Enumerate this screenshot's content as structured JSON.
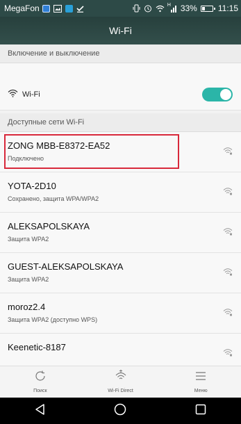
{
  "status_bar": {
    "carrier": "MegaFon",
    "signal_label": "H",
    "battery_text": "33%",
    "battery_level": 0.33,
    "time": "11:15"
  },
  "header": {
    "title": "Wi-Fi"
  },
  "sections": {
    "toggle_header": "Включение и выключение",
    "networks_header": "Доступные сети Wi-Fi"
  },
  "wifi_toggle": {
    "label": "Wi-Fi",
    "enabled": true
  },
  "networks": [
    {
      "name": "ZONG MBB-E8372-EA52",
      "status": "Подключено"
    },
    {
      "name": "YOTA-2D10",
      "status": "Сохранено, защита WPA/WPA2"
    },
    {
      "name": "ALEKSAPOLSKAYA",
      "status": "Защита WPA2"
    },
    {
      "name": "GUEST-ALEKSAPOLSKAYA",
      "status": "Защита WPA2"
    },
    {
      "name": "moroz2.4",
      "status": "Защита WPA2 (доступно WPS)"
    },
    {
      "name": "Keenetic-8187",
      "status": ""
    }
  ],
  "bottom_bar": {
    "search_label": "Поиск",
    "wifi_direct_label": "Wi-Fi Direct",
    "menu_label": "Меню"
  },
  "nav_icons": [
    "back-icon",
    "home-icon",
    "recents-icon"
  ],
  "colors": {
    "status_bar": "#2d4a47",
    "toggle_on": "#2bb5a8",
    "highlight": "#d8283a"
  }
}
